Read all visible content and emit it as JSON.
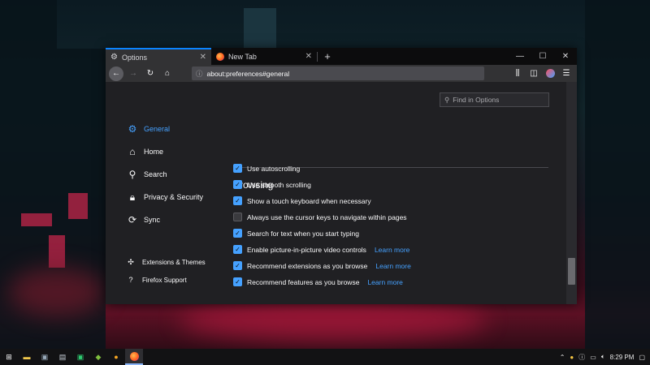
{
  "browser": {
    "tabs": [
      {
        "label": "Options",
        "icon": "gear-icon",
        "active": true
      },
      {
        "label": "New Tab",
        "icon": "firefox-icon",
        "active": false
      }
    ],
    "new_tab_glyph": "+",
    "window_controls": {
      "minimize": "—",
      "maximize": "☐",
      "close": "✕"
    },
    "url": "about:preferences#general"
  },
  "preferences": {
    "find_placeholder": "Find in Options",
    "categories": [
      {
        "label": "General",
        "icon": "gear-icon",
        "selected": true
      },
      {
        "label": "Home",
        "icon": "home-icon",
        "selected": false
      },
      {
        "label": "Search",
        "icon": "search-icon",
        "selected": false
      },
      {
        "label": "Privacy & Security",
        "icon": "lock-icon",
        "selected": false
      },
      {
        "label": "Sync",
        "icon": "sync-icon",
        "selected": false
      }
    ],
    "footer_links": [
      {
        "label": "Extensions & Themes",
        "icon": "puzzle-icon"
      },
      {
        "label": "Firefox Support",
        "icon": "help-icon"
      }
    ],
    "section_title": "Browsing",
    "options": [
      {
        "label": "Use autoscrolling",
        "checked": true,
        "link": ""
      },
      {
        "label": "Use smooth scrolling",
        "checked": true,
        "link": ""
      },
      {
        "label": "Show a touch keyboard when necessary",
        "checked": true,
        "link": ""
      },
      {
        "label": "Always use the cursor keys to navigate within pages",
        "checked": false,
        "link": ""
      },
      {
        "label": "Search for text when you start typing",
        "checked": true,
        "link": ""
      },
      {
        "label": "Enable picture-in-picture video controls",
        "checked": true,
        "link": "Learn more"
      },
      {
        "label": "Recommend extensions as you browse",
        "checked": true,
        "link": "Learn more"
      },
      {
        "label": "Recommend features as you browse",
        "checked": true,
        "link": "Learn more"
      }
    ]
  },
  "taskbar": {
    "time": "8:29 PM",
    "colors": {
      "accent": "#45a1ff",
      "tab_highlight": "#0a84ff"
    }
  }
}
